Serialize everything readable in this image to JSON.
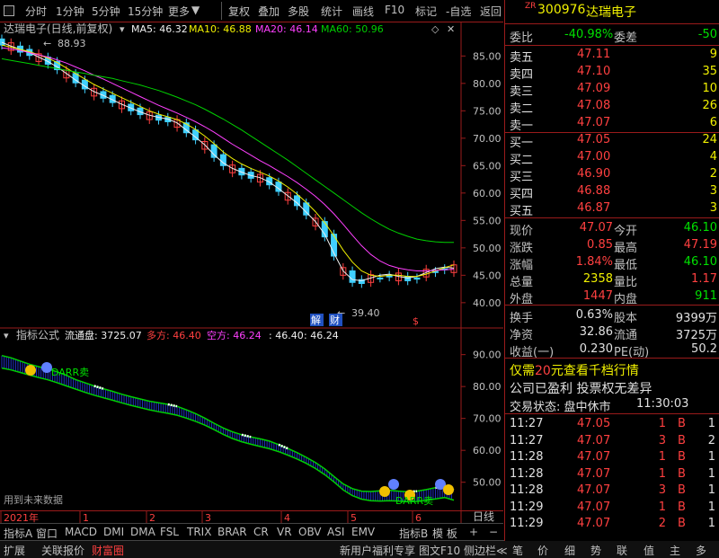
{
  "toolbar": {
    "items": [
      "分时",
      "1分钟",
      "5分钟",
      "15分钟",
      "更多",
      "复权",
      "叠加",
      "多股",
      "统计",
      "画线",
      "F10",
      "标记",
      "-自选",
      "返回"
    ]
  },
  "main_chart": {
    "title": "达瑞电子(日线,前复权)",
    "ma5_label": "MA5: 46.32",
    "ma10_label": "MA10: 46.88",
    "ma20_label": "MA20: 46.14",
    "ma60_label": "MA60: 50.96",
    "high_mark": "88.93",
    "low_mark": "39.40",
    "tag_jie": "解",
    "tag_cai": "财",
    "tag_s": "$",
    "colors": {
      "ma5": "#f0f0f0",
      "ma10": "#f0f000",
      "ma20": "#ff40ff",
      "ma60": "#00d000",
      "up": "#ff4040",
      "down": "#40d0ff"
    }
  },
  "indicator_chart": {
    "title": "指标公式",
    "float_label": "流通盘: 3725.07",
    "long_label": "多方: 46.40",
    "short_label": "空方: 46.24",
    "v1": ": 46.40",
    "v2": ": 46.24",
    "text1": "DARR卖",
    "text2": "DARR卖",
    "future_note": "用到未来数据"
  },
  "chart_data": [
    {
      "type": "line",
      "title": "达瑞电子(日线,前复权)",
      "y_ticks": [
        85.0,
        80.0,
        75.0,
        70.0,
        65.0,
        60.0,
        55.0,
        50.0,
        45.0,
        40.0
      ],
      "ylim": [
        38.5,
        88.0
      ],
      "series": [
        {
          "name": "MA5",
          "values": [
            87.5,
            86.8,
            86.2,
            85.6,
            84.8,
            84.0,
            83.0,
            81.8,
            80.6,
            79.5,
            78.5,
            77.8,
            77.0,
            76.2,
            75.5,
            74.8,
            74.2,
            73.8,
            73.5,
            72.8,
            71.5,
            70.2,
            68.8,
            67.0,
            65.5,
            64.5,
            63.8,
            63.2,
            62.8,
            62.0,
            60.8,
            59.5,
            58.2,
            56.5,
            54.8,
            52.5,
            49.0,
            45.8,
            44.2,
            44.0,
            44.5,
            45.0,
            45.2,
            44.8,
            44.5,
            44.8,
            45.5,
            46.2,
            46.5,
            46.3
          ]
        },
        {
          "name": "MA10",
          "values": [
            87.0,
            86.6,
            86.2,
            85.8,
            85.2,
            84.6,
            83.8,
            82.8,
            81.8,
            80.8,
            79.8,
            79.0,
            78.2,
            77.4,
            76.6,
            75.8,
            75.0,
            74.4,
            73.9,
            73.4,
            72.6,
            71.6,
            70.4,
            69.0,
            67.5,
            66.3,
            65.3,
            64.5,
            63.8,
            63.1,
            62.2,
            61.1,
            59.8,
            58.3,
            56.6,
            54.6,
            52.2,
            49.6,
            47.4,
            45.8,
            45.0,
            44.8,
            45.0,
            45.0,
            44.8,
            44.8,
            45.2,
            45.8,
            46.4,
            46.9
          ]
        },
        {
          "name": "MA20",
          "values": [
            86.5,
            86.3,
            86.0,
            85.6,
            85.2,
            84.8,
            84.3,
            83.7,
            83.0,
            82.3,
            81.5,
            80.8,
            80.0,
            79.2,
            78.4,
            77.6,
            76.8,
            76.0,
            75.3,
            74.6,
            73.8,
            73.0,
            72.1,
            71.1,
            70.0,
            68.9,
            67.9,
            66.9,
            65.9,
            65.0,
            64.0,
            63.0,
            61.9,
            60.7,
            59.4,
            57.9,
            56.2,
            54.3,
            52.3,
            50.4,
            48.8,
            47.6,
            46.8,
            46.3,
            46.0,
            45.8,
            45.8,
            45.9,
            46.0,
            46.1
          ]
        },
        {
          "name": "MA60",
          "values": [
            84.5,
            84.2,
            83.9,
            83.6,
            83.3,
            83.0,
            82.7,
            82.4,
            82.1,
            81.8,
            81.5,
            81.2,
            80.9,
            80.5,
            80.1,
            79.7,
            79.2,
            78.7,
            78.1,
            77.5,
            76.8,
            76.1,
            75.3,
            74.4,
            73.5,
            72.5,
            71.5,
            70.4,
            69.3,
            68.2,
            67.1,
            66.0,
            64.8,
            63.6,
            62.4,
            61.2,
            60.0,
            58.8,
            57.6,
            56.4,
            55.3,
            54.3,
            53.4,
            52.7,
            52.1,
            51.6,
            51.3,
            51.1,
            51.0,
            51.0
          ]
        }
      ],
      "x_labels": [
        "2021年",
        "1",
        "2",
        "3",
        "4",
        "5",
        "6"
      ]
    },
    {
      "type": "area",
      "title": "指标公式",
      "y_ticks": [
        90.0,
        80.0,
        70.0,
        60.0,
        50.0
      ],
      "ylim": [
        44.0,
        93.0
      ],
      "series": [
        {
          "name": "多方",
          "values": [
            88.5,
            87.8,
            86.8,
            85.8,
            85.0,
            84.3,
            83.4,
            82.3,
            81.0,
            80.0,
            79.0,
            78.1,
            77.3,
            76.4,
            75.6,
            74.9,
            74.2,
            73.7,
            73.2,
            72.6,
            71.5,
            70.3,
            68.9,
            67.3,
            65.8,
            64.6,
            63.7,
            63.0,
            62.4,
            61.7,
            60.6,
            59.4,
            58.1,
            56.6,
            55.0,
            53.0,
            50.6,
            48.3,
            46.8,
            46.0,
            45.9,
            46.1,
            46.3,
            46.0,
            45.8,
            46.0,
            46.5,
            47.1,
            47.4,
            46.4
          ]
        },
        {
          "name": "空方",
          "values": [
            87.6,
            87.0,
            86.2,
            85.4,
            84.6,
            83.9,
            83.0,
            82.0,
            81.0,
            80.0,
            79.1,
            78.3,
            77.5,
            76.7,
            75.9,
            75.2,
            74.5,
            73.9,
            73.4,
            72.8,
            71.9,
            70.9,
            69.7,
            68.3,
            66.8,
            65.5,
            64.5,
            63.7,
            63.0,
            62.3,
            61.4,
            60.3,
            59.1,
            57.7,
            56.1,
            54.2,
            51.9,
            49.4,
            47.6,
            46.5,
            46.0,
            45.9,
            46.0,
            45.9,
            45.7,
            45.8,
            46.1,
            46.6,
            47.0,
            46.2
          ]
        }
      ]
    }
  ],
  "quote": {
    "code_prefix": "ZR",
    "code": "300976",
    "name": "达瑞电子",
    "weibi_label": "委比",
    "weibi": "-40.98%",
    "weicha_label": "委差",
    "weicha": "-50",
    "asks": [
      {
        "label": "卖五",
        "price": "47.11",
        "vol": "9"
      },
      {
        "label": "卖四",
        "price": "47.10",
        "vol": "35"
      },
      {
        "label": "卖三",
        "price": "47.09",
        "vol": "10"
      },
      {
        "label": "卖二",
        "price": "47.08",
        "vol": "26"
      },
      {
        "label": "卖一",
        "price": "47.07",
        "vol": "6"
      }
    ],
    "bids": [
      {
        "label": "买一",
        "price": "47.05",
        "vol": "24"
      },
      {
        "label": "买二",
        "price": "47.00",
        "vol": "4"
      },
      {
        "label": "买三",
        "price": "46.90",
        "vol": "2"
      },
      {
        "label": "买四",
        "price": "46.88",
        "vol": "3"
      },
      {
        "label": "买五",
        "price": "46.87",
        "vol": "3"
      }
    ],
    "stats": [
      {
        "l1": "现价",
        "v1": "47.07",
        "c1": "red",
        "l2": "今开",
        "v2": "46.10",
        "c2": "green"
      },
      {
        "l1": "涨跌",
        "v1": "0.85",
        "c1": "red",
        "l2": "最高",
        "v2": "47.19",
        "c2": "red"
      },
      {
        "l1": "涨幅",
        "v1": "1.84%",
        "c1": "red",
        "l2": "最低",
        "v2": "46.10",
        "c2": "green"
      },
      {
        "l1": "总量",
        "v1": "2358",
        "c1": "yellow",
        "l2": "量比",
        "v2": "1.17",
        "c2": "red"
      },
      {
        "l1": "外盘",
        "v1": "1447",
        "c1": "red",
        "l2": "内盘",
        "v2": "911",
        "c2": "green"
      }
    ],
    "stats2": [
      {
        "l1": "换手",
        "v1": "0.63%",
        "l2": "股本",
        "v2": "9399万"
      },
      {
        "l1": "净资",
        "v1": "32.86",
        "l2": "流通",
        "v2": "3725万"
      },
      {
        "l1": "收益(一)",
        "v1": "0.230",
        "l2": "PE(动)",
        "v2": "50.2"
      }
    ],
    "promo_prefix": "仅需",
    "promo_num": "20",
    "promo_suffix": "元查看千档行情",
    "company_note": "公司已盈利 投票权无差异",
    "status_label": "交易状态: 盘中休市",
    "status_time": "11:30:03",
    "ticks": [
      {
        "time": "11:27",
        "price": "47.05",
        "vol": "1",
        "side": "B",
        "n": "1"
      },
      {
        "time": "11:27",
        "price": "47.07",
        "vol": "3",
        "side": "B",
        "n": "2"
      },
      {
        "time": "11:28",
        "price": "47.07",
        "vol": "1",
        "side": "B",
        "n": "1"
      },
      {
        "time": "11:28",
        "price": "47.07",
        "vol": "1",
        "side": "B",
        "n": "1"
      },
      {
        "time": "11:28",
        "price": "47.07",
        "vol": "3",
        "side": "B",
        "n": "1"
      },
      {
        "time": "11:29",
        "price": "47.07",
        "vol": "1",
        "side": "B",
        "n": "1"
      },
      {
        "time": "11:29",
        "price": "47.07",
        "vol": "2",
        "side": "B",
        "n": "1"
      }
    ]
  },
  "bottom1": {
    "items": [
      "指标A",
      "窗口",
      "MACD",
      "DMI",
      "DMA",
      "FSL",
      "TRIX",
      "BRAR",
      "CR",
      "VR",
      "OBV",
      "ASI",
      "EMV",
      "指标B",
      "模 板",
      "+",
      "−"
    ],
    "right_label": "日线"
  },
  "bottom2": {
    "items": [
      "扩展",
      "关联报价",
      "财富圈"
    ],
    "mid_items": [
      "新用户福利专享",
      "图文F10",
      "侧边栏≪"
    ],
    "right_items": [
      "笔",
      "价",
      "细",
      "势",
      "联",
      "值",
      "主",
      "多"
    ]
  }
}
